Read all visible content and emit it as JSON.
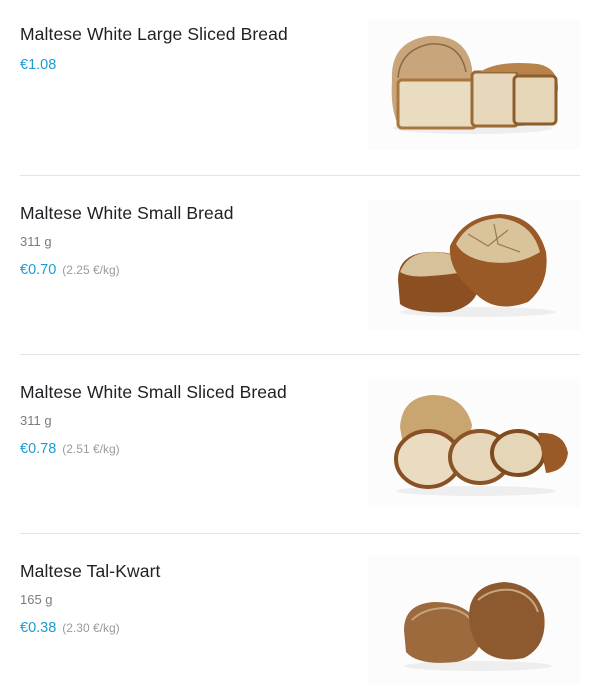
{
  "products": [
    {
      "name": "Maltese White Large Sliced Bread",
      "weight": "",
      "price": "€1.08",
      "unit_price": "",
      "image": "sliced-loaf-image"
    },
    {
      "name": "Maltese White Small Bread",
      "weight": "311 g",
      "price": "€0.70",
      "unit_price": "(2.25 €/kg)",
      "image": "small-loaves-image"
    },
    {
      "name": "Maltese White Small Sliced Bread",
      "weight": "311 g",
      "price": "€0.78",
      "unit_price": "(2.51 €/kg)",
      "image": "small-sliced-loaf-image"
    },
    {
      "name": "Maltese Tal-Kwart",
      "weight": "165 g",
      "price": "€0.38",
      "unit_price": "(2.30 €/kg)",
      "image": "round-rolls-image"
    }
  ],
  "colors": {
    "price": "#1a9bd7",
    "title": "#202125",
    "muted": "#9b9b9b",
    "crust": "#8b5a2b",
    "crumb": "#eadcc0"
  }
}
